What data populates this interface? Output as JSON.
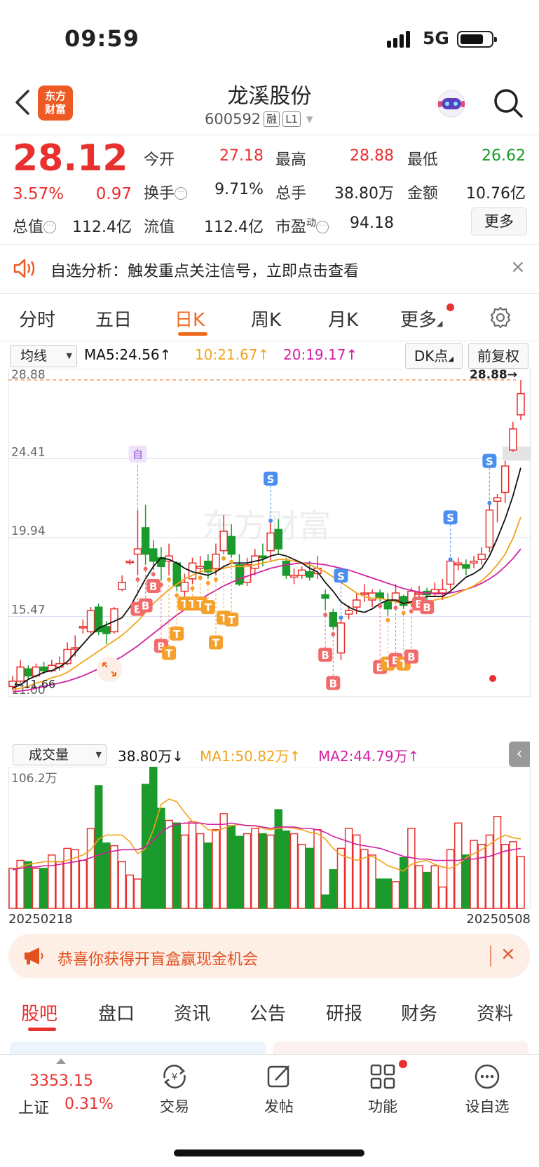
{
  "status": {
    "time": "09:59",
    "network": "5G"
  },
  "header": {
    "brand": "东方财富",
    "brand_line1": "东方",
    "brand_line2": "财富",
    "name": "龙溪股份",
    "code": "600592",
    "tag1": "融",
    "tag2": "L1"
  },
  "quote": {
    "price": "28.12",
    "pct": "3.57%",
    "chg": "0.97",
    "open_label": "今开",
    "open": "27.18",
    "high_label": "最高",
    "high": "28.88",
    "low_label": "最低",
    "low": "26.62",
    "turnover_label": "换手",
    "turnover": "9.71%",
    "vol_label": "总手",
    "vol": "38.80万",
    "amount_label": "金额",
    "amount": "10.76亿",
    "mcap_label": "总值",
    "mcap": "112.4亿",
    "float_label": "流值",
    "float": "112.4亿",
    "pe_label": "市盈",
    "pe_sup": "动",
    "pe": "94.18",
    "more": "更多"
  },
  "notice": {
    "text": "自选分析：触发重点关注信号，立即点击查看"
  },
  "ktabs": [
    "分时",
    "五日",
    "日K",
    "周K",
    "月K",
    "更多"
  ],
  "chart_controls": {
    "ma_select": "均线",
    "ma5": "MA5:24.56↑",
    "ma10": "10:21.67↑",
    "ma20": "20:19.17↑",
    "dk": "DK点",
    "fq": "前复权",
    "vol_select": "成交量",
    "vol": "38.80万↓",
    "vol_ma1": "MA1:50.82万↑",
    "vol_ma2": "MA2:44.79万↑"
  },
  "chart_data": {
    "type": "candlestick",
    "title": "",
    "y_ticks": [
      "28.88",
      "24.41",
      "19.94",
      "15.47",
      "11.00"
    ],
    "ylim": [
      11.0,
      28.88
    ],
    "high_marker": "28.88→",
    "low_marker": "11.66",
    "vol_max_label": "106.2万",
    "vol_ylim": [
      0,
      106.2
    ],
    "start_date": "20250218",
    "end_date": "20250508",
    "watermark": "东方财富",
    "candles": [
      {
        "o": 11.5,
        "c": 11.8,
        "h": 12.1,
        "l": 11.3,
        "v": 30
      },
      {
        "o": 11.8,
        "c": 12.6,
        "h": 13.0,
        "l": 11.7,
        "v": 36
      },
      {
        "o": 12.5,
        "c": 12.1,
        "h": 12.7,
        "l": 11.9,
        "v": 35
      },
      {
        "o": 12.1,
        "c": 12.6,
        "h": 12.8,
        "l": 12.0,
        "v": 30
      },
      {
        "o": 12.6,
        "c": 12.4,
        "h": 12.9,
        "l": 12.2,
        "v": 30
      },
      {
        "o": 12.4,
        "c": 12.7,
        "h": 13.0,
        "l": 12.3,
        "v": 40
      },
      {
        "o": 12.6,
        "c": 12.8,
        "h": 13.2,
        "l": 12.4,
        "v": 35
      },
      {
        "o": 12.8,
        "c": 13.6,
        "h": 14.0,
        "l": 12.7,
        "v": 45
      },
      {
        "o": 13.7,
        "c": 13.7,
        "h": 14.4,
        "l": 13.2,
        "v": 44
      },
      {
        "o": 14.9,
        "c": 14.9,
        "h": 15.3,
        "l": 14.5,
        "v": 36
      },
      {
        "o": 14.6,
        "c": 15.8,
        "h": 16.0,
        "l": 14.5,
        "v": 60
      },
      {
        "o": 16.0,
        "c": 14.6,
        "h": 16.2,
        "l": 14.4,
        "v": 92
      },
      {
        "o": 14.9,
        "c": 14.5,
        "h": 15.2,
        "l": 13.9,
        "v": 49
      },
      {
        "o": 14.6,
        "c": 15.9,
        "h": 16.0,
        "l": 14.5,
        "v": 47
      },
      {
        "o": 17.0,
        "c": 17.4,
        "h": 17.8,
        "l": 16.9,
        "v": 35
      },
      {
        "o": 18.6,
        "c": 18.6,
        "h": 18.7,
        "l": 18.4,
        "v": 25
      },
      {
        "o": 19.0,
        "c": 19.3,
        "h": 21.5,
        "l": 17.8,
        "v": 22
      },
      {
        "o": 20.5,
        "c": 19.0,
        "h": 21.8,
        "l": 18.4,
        "v": 93
      },
      {
        "o": 19.3,
        "c": 18.6,
        "h": 19.8,
        "l": 18.1,
        "v": 106.2
      },
      {
        "o": 18.8,
        "c": 18.3,
        "h": 19.4,
        "l": 17.5,
        "v": 75
      },
      {
        "o": 18.6,
        "c": 18.9,
        "h": 19.6,
        "l": 17.8,
        "v": 66
      },
      {
        "o": 18.5,
        "c": 17.2,
        "h": 18.6,
        "l": 16.9,
        "v": 64
      },
      {
        "o": 16.9,
        "c": 17.4,
        "h": 17.9,
        "l": 16.6,
        "v": 55
      },
      {
        "o": 17.6,
        "c": 18.5,
        "h": 18.8,
        "l": 17.3,
        "v": 65
      },
      {
        "o": 18.2,
        "c": 18.3,
        "h": 18.9,
        "l": 17.9,
        "v": 56
      },
      {
        "o": 18.6,
        "c": 18.0,
        "h": 19.0,
        "l": 17.6,
        "v": 49
      },
      {
        "o": 18.2,
        "c": 19.0,
        "h": 19.6,
        "l": 17.8,
        "v": 59
      },
      {
        "o": 19.2,
        "c": 20.3,
        "h": 21.2,
        "l": 19.0,
        "v": 71
      },
      {
        "o": 20.0,
        "c": 19.0,
        "h": 20.7,
        "l": 18.8,
        "v": 62
      },
      {
        "o": 18.4,
        "c": 17.3,
        "h": 19.0,
        "l": 17.2,
        "v": 54
      },
      {
        "o": 17.4,
        "c": 18.4,
        "h": 18.8,
        "l": 17.2,
        "v": 56
      },
      {
        "o": 18.2,
        "c": 18.9,
        "h": 19.3,
        "l": 17.8,
        "v": 60
      },
      {
        "o": 18.9,
        "c": 18.8,
        "h": 19.6,
        "l": 18.3,
        "v": 56
      },
      {
        "o": 19.2,
        "c": 20.2,
        "h": 20.9,
        "l": 18.6,
        "v": 55
      },
      {
        "o": 20.4,
        "c": 19.3,
        "h": 21.0,
        "l": 19.0,
        "v": 74
      },
      {
        "o": 18.6,
        "c": 17.8,
        "h": 18.8,
        "l": 17.6,
        "v": 58
      },
      {
        "o": 17.7,
        "c": 17.8,
        "h": 18.2,
        "l": 17.3,
        "v": 56
      },
      {
        "o": 17.8,
        "c": 18.1,
        "h": 18.3,
        "l": 17.6,
        "v": 48
      },
      {
        "o": 18.0,
        "c": 17.7,
        "h": 18.6,
        "l": 17.5,
        "v": 45
      },
      {
        "o": 17.9,
        "c": 18.2,
        "h": 18.9,
        "l": 17.6,
        "v": 59
      },
      {
        "o": 16.7,
        "c": 16.5,
        "h": 17.0,
        "l": 15.8,
        "v": 10
      },
      {
        "o": 15.7,
        "c": 14.9,
        "h": 15.9,
        "l": 14.7,
        "v": 29
      },
      {
        "o": 13.4,
        "c": 15.1,
        "h": 15.4,
        "l": 13.0,
        "v": 45
      },
      {
        "o": 15.6,
        "c": 15.8,
        "h": 16.1,
        "l": 15.3,
        "v": 60
      },
      {
        "o": 16.0,
        "c": 16.4,
        "h": 16.8,
        "l": 15.6,
        "v": 55
      },
      {
        "o": 16.8,
        "c": 16.8,
        "h": 17.3,
        "l": 16.3,
        "v": 44
      },
      {
        "o": 16.4,
        "c": 16.8,
        "h": 17.0,
        "l": 16.0,
        "v": 40
      },
      {
        "o": 16.8,
        "c": 16.5,
        "h": 17.0,
        "l": 16.3,
        "v": 22
      },
      {
        "o": 16.3,
        "c": 15.9,
        "h": 16.8,
        "l": 15.5,
        "v": 22
      },
      {
        "o": 16.4,
        "c": 16.8,
        "h": 17.3,
        "l": 16.2,
        "v": 20
      },
      {
        "o": 16.6,
        "c": 16.1,
        "h": 16.7,
        "l": 15.9,
        "v": 38
      },
      {
        "o": 16.3,
        "c": 16.9,
        "h": 17.1,
        "l": 16.0,
        "v": 60
      },
      {
        "o": 16.8,
        "c": 16.8,
        "h": 17.2,
        "l": 16.3,
        "v": 32
      },
      {
        "o": 16.9,
        "c": 16.7,
        "h": 17.1,
        "l": 16.3,
        "v": 27
      },
      {
        "o": 16.8,
        "c": 17.0,
        "h": 17.4,
        "l": 16.6,
        "v": 32
      },
      {
        "o": 16.8,
        "c": 17.0,
        "h": 17.6,
        "l": 16.4,
        "v": 16
      },
      {
        "o": 17.3,
        "c": 18.6,
        "h": 18.7,
        "l": 17.0,
        "v": 44
      },
      {
        "o": 18.4,
        "c": 18.5,
        "h": 18.8,
        "l": 18.1,
        "v": 64
      },
      {
        "o": 18.4,
        "c": 18.2,
        "h": 18.7,
        "l": 17.8,
        "v": 40
      },
      {
        "o": 18.5,
        "c": 18.6,
        "h": 18.9,
        "l": 18.2,
        "v": 51
      },
      {
        "o": 18.7,
        "c": 19.0,
        "h": 19.4,
        "l": 18.4,
        "v": 48
      },
      {
        "o": 19.4,
        "c": 21.5,
        "h": 21.9,
        "l": 19.1,
        "v": 55
      },
      {
        "o": 22.0,
        "c": 22.2,
        "h": 22.4,
        "l": 20.8,
        "v": 69
      },
      {
        "o": 22.5,
        "c": 24.0,
        "h": 24.3,
        "l": 21.9,
        "v": 48
      },
      {
        "o": 24.9,
        "c": 26.1,
        "h": 26.5,
        "l": 24.8,
        "v": 50
      },
      {
        "o": 26.9,
        "c": 28.1,
        "h": 28.88,
        "l": 26.6,
        "v": 38.8
      }
    ],
    "ma5": [
      11.4,
      11.6,
      11.9,
      12.1,
      12.3,
      12.4,
      12.6,
      12.9,
      13.4,
      13.9,
      14.4,
      14.8,
      15.0,
      15.2,
      15.4,
      16.0,
      16.8,
      17.6,
      18.3,
      18.8,
      18.7,
      18.5,
      18.2,
      18.0,
      17.9,
      17.8,
      18.0,
      18.3,
      18.5,
      18.5,
      18.5,
      18.6,
      18.7,
      18.9,
      19.0,
      18.9,
      18.7,
      18.5,
      18.2,
      18.0,
      17.4,
      16.9,
      16.3,
      16.0,
      15.8,
      15.7,
      15.9,
      16.2,
      16.4,
      16.4,
      16.2,
      16.3,
      16.4,
      16.6,
      16.6,
      16.6,
      16.9,
      17.3,
      17.7,
      17.9,
      18.2,
      18.9,
      19.9,
      21.0,
      22.3,
      23.9
    ],
    "ma10": [
      11.3,
      11.4,
      11.5,
      11.7,
      11.8,
      12.0,
      12.1,
      12.3,
      12.6,
      12.9,
      13.2,
      13.5,
      13.8,
      14.1,
      14.4,
      14.8,
      15.2,
      15.7,
      16.2,
      16.6,
      17.0,
      17.3,
      17.6,
      17.8,
      18.0,
      18.1,
      18.1,
      18.2,
      18.3,
      18.3,
      18.3,
      18.4,
      18.5,
      18.6,
      18.7,
      18.7,
      18.6,
      18.5,
      18.4,
      18.2,
      18.0,
      17.7,
      17.4,
      17.1,
      16.8,
      16.6,
      16.5,
      16.5,
      16.4,
      16.3,
      16.2,
      16.2,
      16.2,
      16.3,
      16.4,
      16.5,
      16.6,
      16.8,
      17.0,
      17.2,
      17.5,
      17.9,
      18.4,
      19.0,
      19.9,
      21.1
    ],
    "ma20": [
      11.2,
      11.25,
      11.3,
      11.4,
      11.5,
      11.6,
      11.7,
      11.8,
      11.95,
      12.1,
      12.3,
      12.5,
      12.7,
      12.95,
      13.2,
      13.5,
      13.8,
      14.15,
      14.5,
      14.85,
      15.2,
      15.55,
      15.85,
      16.15,
      16.45,
      16.7,
      16.95,
      17.2,
      17.4,
      17.6,
      17.75,
      17.9,
      18.05,
      18.2,
      18.3,
      18.4,
      18.45,
      18.5,
      18.5,
      18.45,
      18.4,
      18.3,
      18.2,
      18.1,
      17.95,
      17.8,
      17.65,
      17.5,
      17.35,
      17.2,
      17.05,
      16.95,
      16.85,
      16.8,
      16.75,
      16.75,
      16.8,
      16.9,
      17.0,
      17.15,
      17.35,
      17.6,
      17.9,
      18.3,
      18.75,
      19.3
    ],
    "vol_ma1": [
      29,
      31,
      33,
      34,
      35,
      35,
      35,
      36,
      38,
      40,
      44,
      52,
      55,
      55,
      55,
      50,
      41,
      45,
      59,
      78,
      82,
      80,
      72,
      65,
      64,
      59,
      58,
      60,
      62,
      63,
      62,
      62,
      60,
      59,
      60,
      61,
      60,
      59,
      57,
      56,
      52,
      45,
      40,
      38,
      36,
      38,
      39,
      36,
      32,
      30,
      28,
      33,
      35,
      36,
      33,
      31,
      30,
      33,
      38,
      41,
      44,
      48,
      52,
      55,
      53,
      52
    ],
    "vol_ma2": [
      29,
      30,
      31,
      31,
      32,
      32,
      33,
      34,
      35,
      36,
      38,
      40,
      42,
      43,
      44,
      44,
      44,
      46,
      51,
      57,
      61,
      63,
      64,
      64,
      64,
      63,
      63,
      63,
      64,
      63,
      62,
      62,
      61,
      60,
      61,
      61,
      61,
      60,
      60,
      59,
      57,
      54,
      52,
      50,
      48,
      47,
      46,
      45,
      43,
      41,
      39,
      38,
      37,
      37,
      36,
      36,
      36,
      36,
      37,
      37,
      38,
      39,
      41,
      43,
      44,
      45
    ],
    "signals": [
      {
        "i": 16,
        "t": "自"
      },
      {
        "i": 33,
        "t": "S"
      },
      {
        "i": 42,
        "t": "S"
      },
      {
        "i": 56,
        "t": "S"
      },
      {
        "i": 61,
        "t": "S"
      },
      {
        "i": 16,
        "t": "B",
        "p": 15.9
      },
      {
        "i": 17,
        "t": "B",
        "p": 16.1
      },
      {
        "i": 18,
        "t": "B",
        "p": 17.2
      },
      {
        "i": 19,
        "t": "B",
        "p": 13.8
      },
      {
        "i": 20,
        "t": "T",
        "p": 13.4
      },
      {
        "i": 21,
        "t": "T",
        "p": 14.5
      },
      {
        "i": 22,
        "t": "T",
        "p": 16.2
      },
      {
        "i": 23,
        "t": "T",
        "p": 16.2
      },
      {
        "i": 24,
        "t": "T",
        "p": 16.2
      },
      {
        "i": 25,
        "t": "T",
        "p": 16.0
      },
      {
        "i": 26,
        "t": "T",
        "p": 14.0
      },
      {
        "i": 27,
        "t": "T",
        "p": 15.4
      },
      {
        "i": 28,
        "t": "T",
        "p": 15.3
      },
      {
        "i": 40,
        "t": "B",
        "p": 13.3
      },
      {
        "i": 41,
        "t": "B",
        "p": 11.7
      },
      {
        "i": 47,
        "t": "B",
        "p": 12.6
      },
      {
        "i": 48,
        "t": "T",
        "p": 12.8
      },
      {
        "i": 49,
        "t": "B",
        "p": 13.0
      },
      {
        "i": 50,
        "t": "T",
        "p": 12.8
      },
      {
        "i": 51,
        "t": "B",
        "p": 13.2
      },
      {
        "i": 52,
        "t": "B",
        "p": 16.2
      },
      {
        "i": 53,
        "t": "B",
        "p": 16.0
      }
    ]
  },
  "promo": {
    "text": "恭喜你获得开盲盒赢现金机会"
  },
  "btabs": [
    "股吧",
    "盘口",
    "资讯",
    "公告",
    "研报",
    "财务",
    "资料"
  ],
  "bottom_nav": {
    "index_value": "3353.15",
    "index_name": "上证",
    "index_pct": "0.31%",
    "items": [
      "交易",
      "发帖",
      "功能",
      "设自选"
    ]
  },
  "colors": {
    "up": "#e8312f",
    "down": "#1a9b2c",
    "accent": "#f06a1e",
    "ma10": "#f2a31b",
    "ma20": "#d21fa0"
  }
}
